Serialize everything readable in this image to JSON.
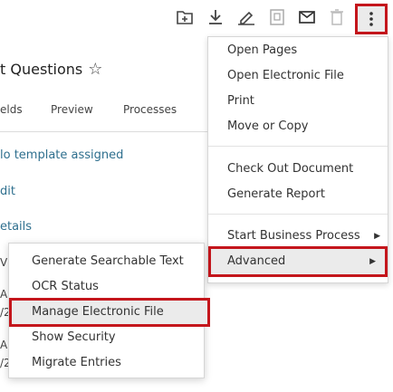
{
  "toolbar": {
    "icons": [
      "new-folder-icon",
      "download-icon",
      "sign-icon",
      "document-icon",
      "email-icon",
      "delete-icon",
      "more-vertical-icon"
    ]
  },
  "page": {
    "title_fragment": "t Questions",
    "star": "☆",
    "tabs": [
      "elds",
      "Preview",
      "Processes"
    ],
    "links": [
      "lo template assigned",
      "dit",
      "etails"
    ],
    "fragments": [
      "V",
      "A",
      "/2",
      "A",
      "/2"
    ]
  },
  "menu": {
    "items_group1": [
      "Open Pages",
      "Open Electronic File",
      "Print",
      "Move or Copy"
    ],
    "items_group2": [
      "Check Out Document",
      "Generate Report"
    ],
    "start_business_process": "Start Business Process",
    "advanced": "Advanced",
    "arrow": "▶"
  },
  "submenu": {
    "items": [
      "Generate Searchable Text",
      "OCR Status",
      "Manage Electronic File",
      "Show Security",
      "Migrate Entries"
    ]
  },
  "colors": {
    "highlight_border": "#c4161c",
    "highlight_bg": "#ebebeb",
    "link": "#2e6f8e"
  }
}
